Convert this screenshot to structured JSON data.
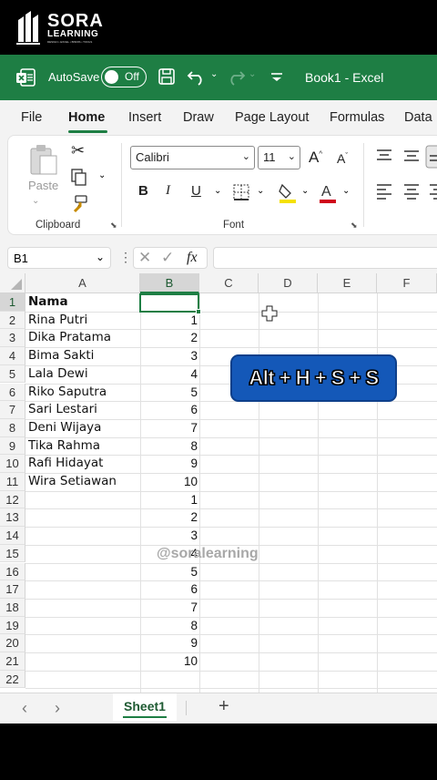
{
  "brand": {
    "name": "SORA",
    "sub": "LEARNING",
    "tagline": "DESIGN • EXCEL • BISNIS • TOOLS"
  },
  "titlebar": {
    "autosave_label": "AutoSave",
    "toggle_label": "Off",
    "doc_title": "Book1  -  Excel"
  },
  "tabs": [
    "File",
    "Home",
    "Insert",
    "Draw",
    "Page Layout",
    "Formulas",
    "Data"
  ],
  "ribbon": {
    "paste_label": "Paste",
    "clipboard_label": "Clipboard",
    "font_name": "Calibri",
    "font_size": "11",
    "font_group_label": "Font",
    "bold": "B",
    "italic": "I",
    "underline": "U"
  },
  "formula_bar": {
    "name_box": "B1",
    "fx": "fx",
    "value": ""
  },
  "grid": {
    "columns": [
      "A",
      "B",
      "C",
      "D",
      "E",
      "F"
    ],
    "selected_column": "B",
    "rows": [
      "1",
      "2",
      "3",
      "4",
      "5",
      "6",
      "7",
      "8",
      "9",
      "10",
      "11",
      "12",
      "13",
      "14",
      "15",
      "16",
      "17",
      "18",
      "19",
      "20",
      "21",
      "22"
    ],
    "col_a": [
      "Nama",
      "Rina Putri",
      "Dika Pratama",
      "Bima Sakti",
      "Lala Dewi",
      "Riko Saputra",
      "Sari Lestari",
      "Deni Wijaya",
      "Tika Rahma",
      "Rafi Hidayat",
      "Wira Setiawan"
    ],
    "col_b": [
      "",
      "1",
      "2",
      "3",
      "4",
      "5",
      "6",
      "7",
      "8",
      "9",
      "10",
      "1",
      "2",
      "3",
      "4",
      "5",
      "6",
      "7",
      "8",
      "9",
      "10"
    ]
  },
  "overlay": {
    "shortcut": "Alt + H + S + S",
    "watermark": "@soralearning"
  },
  "sheets": {
    "active": "Sheet1",
    "add": "+"
  },
  "colors": {
    "excel_green": "#1e7e44",
    "shortcut_bg": "#1458b8"
  }
}
